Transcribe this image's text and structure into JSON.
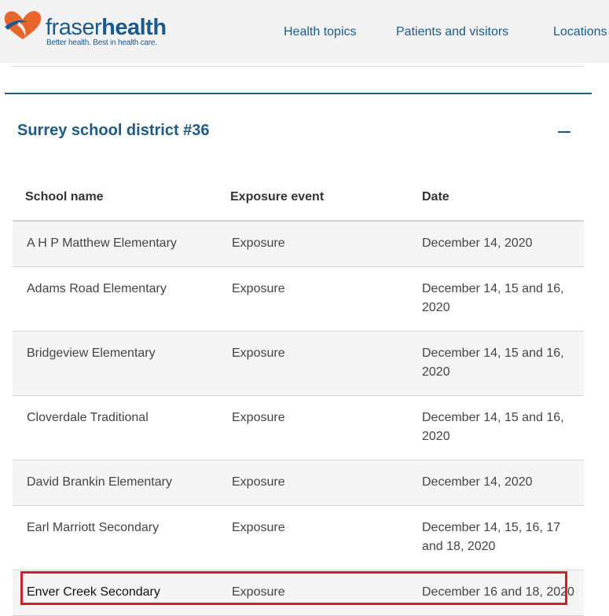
{
  "header": {
    "logo": {
      "wordmark_light": "fraser",
      "wordmark_bold": "health",
      "tagline": "Better health. Best in health care."
    },
    "nav": [
      {
        "label": "Health topics"
      },
      {
        "label": "Patients and visitors"
      },
      {
        "label": "Locations"
      }
    ]
  },
  "section": {
    "title": "Surrey school district #36",
    "toggle_icon": "minus-icon"
  },
  "table": {
    "columns": [
      "School name",
      "Exposure event",
      "Date"
    ],
    "rows": [
      {
        "school": "A H P Matthew Elementary",
        "event": "Exposure",
        "date": "December 14, 2020"
      },
      {
        "school": "Adams Road Elementary",
        "event": "Exposure",
        "date": "December 14, 15 and 16, 2020"
      },
      {
        "school": "Bridgeview Elementary",
        "event": "Exposure",
        "date": "December 14, 15 and 16, 2020"
      },
      {
        "school": "Cloverdale Traditional",
        "event": "Exposure",
        "date": "December 14, 15 and 16, 2020"
      },
      {
        "school": "David Brankin Elementary",
        "event": "Exposure",
        "date": "December 14, 2020"
      },
      {
        "school": "Earl Marriott Secondary",
        "event": "Exposure",
        "date": "December 14, 15, 16, 17 and 18, 2020"
      },
      {
        "school": "Enver Creek Secondary",
        "event": "Exposure",
        "date": "December 16 and 18, 2020"
      }
    ]
  },
  "colors": {
    "brand_blue": "#1d5a87",
    "logo_orange": "#e8662c",
    "highlight_red": "#d0202a",
    "header_bg": "#f2f2f2",
    "row_alt_bg": "#f5f5f5"
  }
}
